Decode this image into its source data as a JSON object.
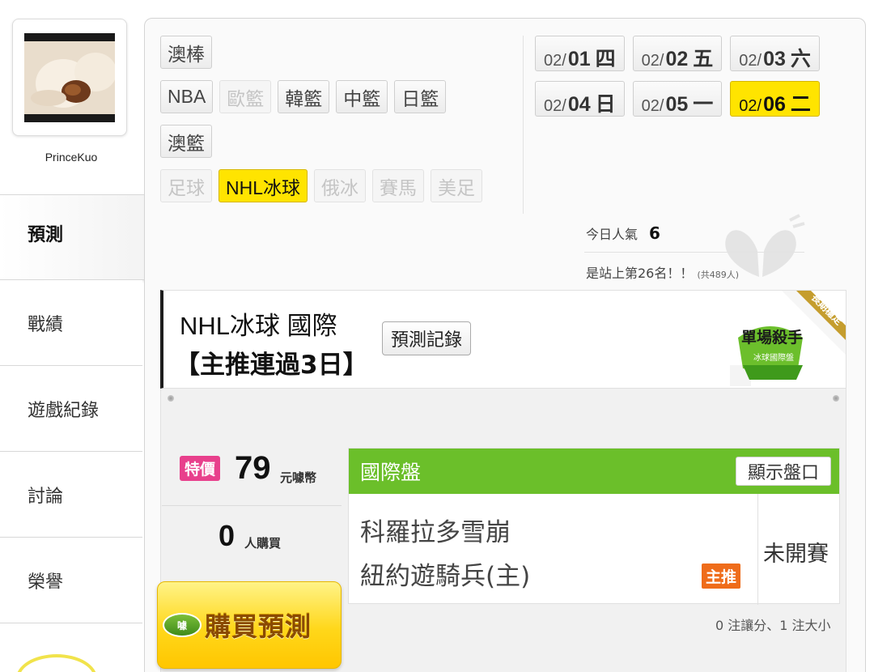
{
  "user": {
    "name": "PrinceKuo"
  },
  "nav": {
    "items": [
      {
        "label": "預測",
        "active": true
      },
      {
        "label": "戰績",
        "active": false
      },
      {
        "label": "遊戲紀錄",
        "active": false
      },
      {
        "label": "討論",
        "active": false
      },
      {
        "label": "榮譽",
        "active": false
      }
    ]
  },
  "sports": {
    "rows": [
      [
        {
          "label": "澳棒",
          "state": "normal"
        }
      ],
      [
        {
          "label": "NBA",
          "state": "normal"
        },
        {
          "label": "歐籃",
          "state": "disabled"
        },
        {
          "label": "韓籃",
          "state": "normal"
        },
        {
          "label": "中籃",
          "state": "normal"
        },
        {
          "label": "日籃",
          "state": "normal"
        }
      ],
      [
        {
          "label": "澳籃",
          "state": "normal"
        }
      ],
      [
        {
          "label": "足球",
          "state": "disabled"
        },
        {
          "label": "NHL冰球",
          "state": "active"
        },
        {
          "label": "俄冰",
          "state": "disabled"
        },
        {
          "label": "賽馬",
          "state": "disabled"
        },
        {
          "label": "美足",
          "state": "disabled"
        }
      ]
    ]
  },
  "dates": {
    "rows": [
      [
        {
          "month": "02/",
          "day": "01",
          "weekday": "四",
          "active": false
        },
        {
          "month": "02/",
          "day": "02",
          "weekday": "五",
          "active": false
        },
        {
          "month": "02/",
          "day": "03",
          "weekday": "六",
          "active": false
        }
      ],
      [
        {
          "month": "02/",
          "day": "04",
          "weekday": "日",
          "active": false
        },
        {
          "month": "02/",
          "day": "05",
          "weekday": "一",
          "active": false
        },
        {
          "month": "02/",
          "day": "06",
          "weekday": "二",
          "active": true
        }
      ]
    ]
  },
  "stats": {
    "popularity_label": "今日人氣",
    "popularity_value": "6",
    "rank_text": "是站上第26名！！",
    "rank_total": "(共489人)"
  },
  "prediction": {
    "title": "NHL冰球 國際",
    "subtitle": "【主推連過3日】",
    "record_button": "預測記錄",
    "badge_main": "單場殺手",
    "badge_sub": "冰球國際盤",
    "ribbon": "長期穩定",
    "sale_tag": "特價",
    "price": "79",
    "price_unit": "元噱幣",
    "buyers": "0",
    "buyers_unit": "人購買",
    "buy_icon": "噱",
    "buy_button": "購買預測",
    "market_title": "國際盤",
    "show_odds_button": "顯示盤口",
    "away_team": "科羅拉多雪崩",
    "home_team": "紐約遊騎兵(主)",
    "pick_tag": "主推",
    "game_status": "未開賽",
    "summary": "0 注讓分、1 注大小"
  },
  "colors": {
    "accent_yellow": "#ffe400",
    "market_green": "#6bbf2a",
    "sale_pink": "#e8408c",
    "pick_orange": "#ef6c1a"
  }
}
